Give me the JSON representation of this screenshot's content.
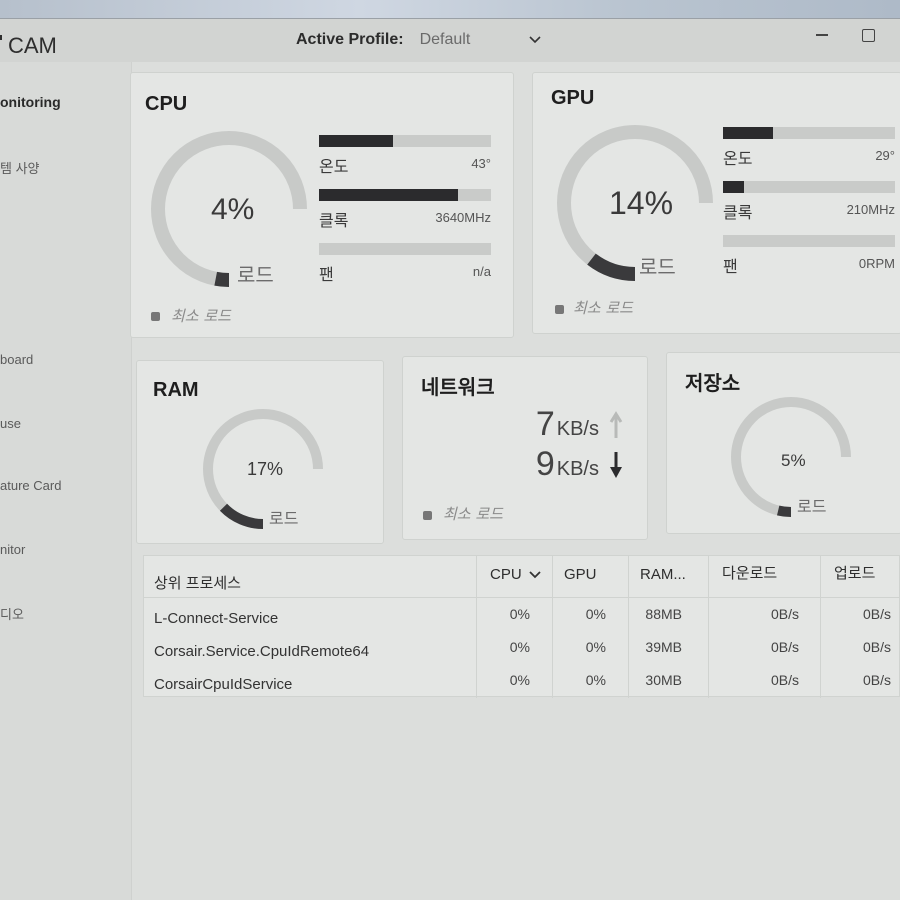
{
  "app": {
    "logo_text": "CAM",
    "active_profile_label": "Active Profile:",
    "active_profile_value": "Default"
  },
  "sidebar": {
    "items": [
      {
        "label": "onitoring",
        "active": true
      },
      {
        "label": "템 사양",
        "active": false
      },
      {
        "label": "board",
        "active": false
      },
      {
        "label": "use",
        "active": false
      },
      {
        "label": "ature Card",
        "active": false
      },
      {
        "label": "nitor",
        "active": false
      },
      {
        "label": "디오",
        "active": false
      }
    ]
  },
  "cpu": {
    "title": "CPU",
    "load_percent": 4,
    "load_text": "4%",
    "gauge_label": "로드",
    "legend": "최소 로드",
    "metrics": [
      {
        "label": "온도",
        "value": "43°",
        "fill": 0.43
      },
      {
        "label": "클록",
        "value": "3640MHz",
        "fill": 0.81
      },
      {
        "label": "팬",
        "value": "n/a",
        "fill": 0
      }
    ]
  },
  "gpu": {
    "title": "GPU",
    "load_percent": 14,
    "load_text": "14%",
    "gauge_label": "로드",
    "legend": "최소 로드",
    "metrics": [
      {
        "label": "온도",
        "value": "29°",
        "fill": 0.29
      },
      {
        "label": "클록",
        "value": "210MHz",
        "fill": 0.12
      },
      {
        "label": "팬",
        "value": "0RPM",
        "fill": 0
      }
    ]
  },
  "ram": {
    "title": "RAM",
    "load_percent": 17,
    "load_text": "17%",
    "gauge_label": "로드"
  },
  "network": {
    "title": "네트워크",
    "upload_value": "7",
    "upload_unit": "KB/s",
    "download_value": "9",
    "download_unit": "KB/s",
    "legend": "최소 로드"
  },
  "storage": {
    "title": "저장소",
    "load_percent": 5,
    "load_text": "5%",
    "gauge_label": "로드"
  },
  "processes": {
    "headers": {
      "name": "상위 프로세스",
      "cpu": "CPU",
      "gpu": "GPU",
      "ram": "RAM...",
      "download": "다운로드",
      "upload": "업로드"
    },
    "rows": [
      {
        "name": "L-Connect-Service",
        "cpu": "0%",
        "gpu": "0%",
        "ram": "88MB",
        "download": "0B/s",
        "upload": "0B/s"
      },
      {
        "name": "Corsair.Service.CpuIdRemote64",
        "cpu": "0%",
        "gpu": "0%",
        "ram": "39MB",
        "download": "0B/s",
        "upload": "0B/s"
      },
      {
        "name": "CorsairCpuIdService",
        "cpu": "0%",
        "gpu": "0%",
        "ram": "30MB",
        "download": "0B/s",
        "upload": "0B/s"
      }
    ]
  },
  "colors": {
    "gauge_track": "#c8cac8",
    "gauge_fill": "#3a3a3c",
    "bar_fill": "#2b2b2d"
  }
}
